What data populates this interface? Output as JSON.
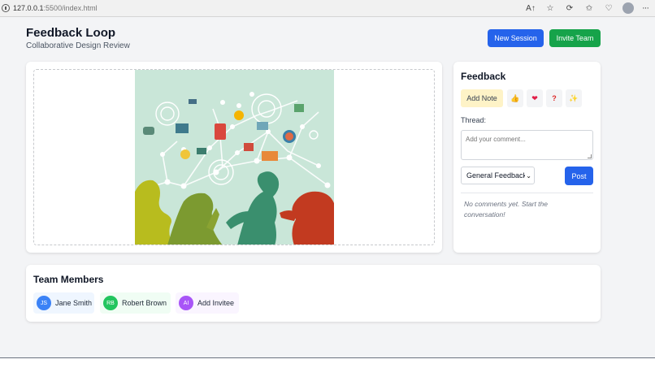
{
  "browser": {
    "url_host": "127.0.0.1",
    "url_path": ":5500/index.html"
  },
  "header": {
    "title": "Feedback Loop",
    "subtitle": "Collaborative Design Review",
    "new_session": "New Session",
    "invite_team": "Invite Team"
  },
  "feedback": {
    "title": "Feedback",
    "add_note": "Add Note",
    "reactions": [
      "👍",
      "❤",
      "?",
      "✨"
    ],
    "thread_label": "Thread:",
    "comment_placeholder": "Add your comment...",
    "category": "General Feedback",
    "post": "Post",
    "empty": "No comments yet. Start the conversation!"
  },
  "team": {
    "title": "Team Members",
    "members": [
      {
        "initials": "JS",
        "name": "Jane Smith",
        "color": "#3b82f6",
        "bg": "#eff6ff"
      },
      {
        "initials": "RB",
        "name": "Robert Brown",
        "color": "#22c55e",
        "bg": "#f0fdf4"
      },
      {
        "initials": "AI",
        "name": "Add Invitee",
        "color": "#a855f7",
        "bg": "#faf5ff"
      }
    ]
  },
  "colors": {
    "primary": "#2563eb",
    "success": "#16a34a",
    "note": "#fef3c7"
  }
}
